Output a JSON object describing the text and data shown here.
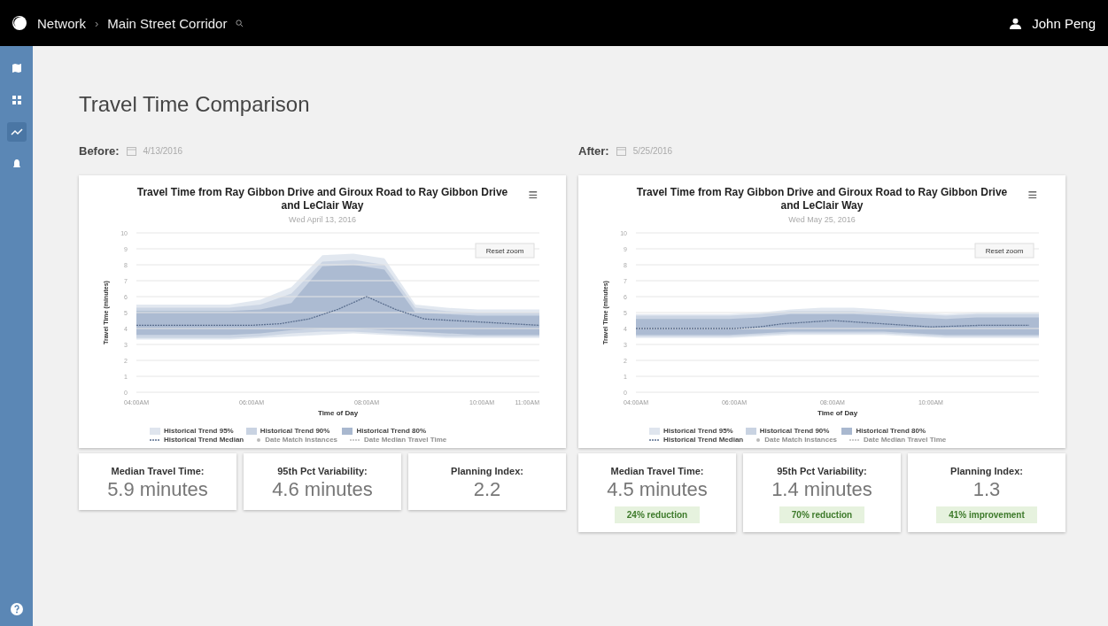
{
  "header": {
    "breadcrumb": [
      "Network",
      "Main Street Corridor"
    ],
    "separator": "›",
    "user": "John Peng"
  },
  "sidebar": {
    "items": [
      {
        "selected": false
      },
      {
        "selected": false
      },
      {
        "selected": true
      },
      {
        "selected": false
      }
    ]
  },
  "title": "Travel Time Comparison",
  "panels": [
    {
      "label": "Before:",
      "date": "4/13/2016",
      "chart": {
        "title": "Travel Time from Ray Gibbon Drive and Giroux Road to Ray Gibbon Drive and LeClair Way",
        "subtitle": "Wed April 13, 2016",
        "reset": "Reset zoom",
        "legend": [
          {
            "label": "Historical Trend 95%",
            "kind": "band",
            "color": "#dfe5ee",
            "hidden": false
          },
          {
            "label": "Historical Trend 90%",
            "kind": "band",
            "color": "#c9d3e2",
            "hidden": false
          },
          {
            "label": "Historical Trend 80%",
            "kind": "band",
            "color": "#a9b8cf",
            "hidden": false
          },
          {
            "label": "Date Match Instances",
            "kind": "dot",
            "hidden": true
          },
          {
            "label": "Date Median Travel Time",
            "kind": "line",
            "hidden": true
          }
        ],
        "chart_data": {
          "type": "line",
          "grid": true,
          "xlabel": "Time of Day",
          "ylabel": "Travel Time (minutes)",
          "x": [
            4,
            5,
            6,
            6.5,
            7,
            7.5,
            8,
            8.5,
            9,
            10,
            10.5,
            11
          ],
          "xlim": [
            4,
            11
          ],
          "ylim": [
            0,
            10
          ],
          "yticks": [
            0,
            1,
            2,
            3,
            4,
            5,
            6,
            7,
            8,
            9,
            10
          ],
          "xticks": [
            {
              "value": 4,
              "label": "04:00AM"
            },
            {
              "value": 6,
              "label": "06:00AM"
            },
            {
              "value": 8,
              "label": "08:00AM"
            },
            {
              "value": 10,
              "label": "10:00AM"
            },
            {
              "value": 11,
              "label": "11:00AM"
            }
          ],
          "series": [
            {
              "name": "Historical Trend Median",
              "line_style": "dashed",
              "color": "#5b6f8f",
              "values": [
                4.2,
                4.2,
                4.2,
                4.3,
                4.6,
                5.2,
                6.0,
                5.2,
                4.6,
                4.4,
                4.3,
                4.2
              ]
            }
          ]
        },
        "menu": "≡"
      },
      "stats": [
        {
          "label": "Median Travel Time:",
          "value": "5.9 minutes"
        },
        {
          "label": "95th Pct Variability:",
          "value": "4.6 minutes"
        },
        {
          "label": "Planning Index:",
          "value": "2.2"
        }
      ]
    },
    {
      "label": "After:",
      "date": "5/25/2016",
      "chart": {
        "title": "Travel Time from Ray Gibbon Drive and Giroux Road to Ray Gibbon Drive and LeClair Way",
        "subtitle": "Wed May 25, 2016",
        "reset": "Reset zoom",
        "legend": [
          {
            "label": "Historical Trend 95%",
            "kind": "band",
            "color": "#dfe5ee",
            "hidden": false
          },
          {
            "label": "Historical Trend 90%",
            "kind": "band",
            "color": "#c9d3e2",
            "hidden": false
          },
          {
            "label": "Historical Trend 80%",
            "kind": "band",
            "color": "#a9b8cf",
            "hidden": false
          },
          {
            "label": "Date Match Instances",
            "kind": "dot",
            "hidden": true
          },
          {
            "label": "Date Median Travel Time",
            "kind": "line",
            "hidden": true
          }
        ],
        "chart_data": {
          "type": "line",
          "grid": true,
          "xlabel": "Time of Day",
          "ylabel": "Travel Time (minutes)",
          "x": [
            4,
            5,
            6,
            6.5,
            7,
            7.5,
            8,
            8.5,
            9,
            10,
            11,
            12
          ],
          "xlim": [
            4,
            12.2
          ],
          "ylim": [
            0,
            10
          ],
          "yticks": [
            0,
            1,
            2,
            3,
            4,
            5,
            6,
            7,
            8,
            9,
            10
          ],
          "xticks": [
            {
              "value": 4,
              "label": "04:00AM"
            },
            {
              "value": 6,
              "label": "06:00AM"
            },
            {
              "value": 8,
              "label": "08:00AM"
            },
            {
              "value": 10,
              "label": "10:00AM"
            }
          ],
          "series": [
            {
              "name": "Historical Trend Median",
              "line_style": "dashed",
              "color": "#5b6f8f",
              "values": [
                4.0,
                4.0,
                4.0,
                4.1,
                4.3,
                4.4,
                4.5,
                4.4,
                4.3,
                4.1,
                4.2,
                4.2
              ]
            }
          ]
        },
        "menu": "≡"
      },
      "stats": [
        {
          "label": "Median Travel Time:",
          "value": "4.5 minutes",
          "change": "24% reduction"
        },
        {
          "label": "95th Pct Variability:",
          "value": "1.4 minutes",
          "change": "70% reduction"
        },
        {
          "label": "Planning Index:",
          "value": "1.3",
          "change": "41% improvement"
        }
      ]
    }
  ]
}
